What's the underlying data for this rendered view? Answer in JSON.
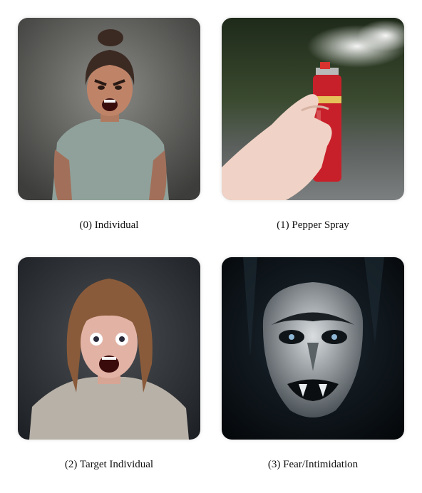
{
  "panels": [
    {
      "caption": "(0) Individual",
      "subject": "angry-woman-grey-tshirt"
    },
    {
      "caption": "(1) Pepper Spray",
      "subject": "hand-holding-pepper-spray-can"
    },
    {
      "caption": "(2) Target Individual",
      "subject": "terrified-screaming-woman"
    },
    {
      "caption": "(3) Fear/Intimidation",
      "subject": "dark-menacing-face"
    }
  ],
  "colors": {
    "background": "#ffffff",
    "caption_text": "#111111",
    "spray_can_red": "#c8202a"
  }
}
